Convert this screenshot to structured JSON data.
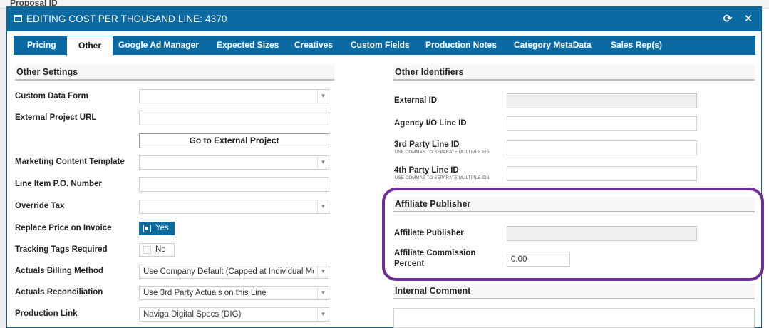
{
  "background": {
    "top_text": "Proposal ID"
  },
  "dialog": {
    "title": "EDITING COST PER THOUSAND LINE: 4370",
    "refresh_icon": "refresh-icon",
    "close_icon": "close-icon",
    "close_glyph": "✕",
    "refresh_glyph": "⟳"
  },
  "tabs": [
    {
      "label": "Pricing",
      "active": false
    },
    {
      "label": "Other",
      "active": true
    },
    {
      "label": "Google Ad Manager",
      "active": false
    },
    {
      "label": "Expected Sizes",
      "active": false
    },
    {
      "label": "Creatives",
      "active": false
    },
    {
      "label": "Custom Fields",
      "active": false
    },
    {
      "label": "Production Notes",
      "active": false
    },
    {
      "label": "Category MetaData",
      "active": false
    },
    {
      "label": "Sales Rep(s)",
      "active": false
    }
  ],
  "other_settings": {
    "heading": "Other Settings",
    "custom_data_form": {
      "label": "Custom Data Form",
      "value": ""
    },
    "external_project_url": {
      "label": "External Project URL",
      "value": ""
    },
    "go_to_external_project": "Go to External Project",
    "marketing_content_template": {
      "label": "Marketing Content Template",
      "value": ""
    },
    "line_item_po_number": {
      "label": "Line Item P.O. Number",
      "value": ""
    },
    "override_tax": {
      "label": "Override Tax",
      "value": ""
    },
    "replace_price_on_invoice": {
      "label": "Replace Price on Invoice",
      "value": "Yes",
      "checked": true
    },
    "tracking_tags_required": {
      "label": "Tracking Tags Required",
      "value": "No",
      "checked": false
    },
    "actuals_billing_method": {
      "label": "Actuals Billing Method",
      "value": "Use Company Default (Capped at Individual Mo"
    },
    "actuals_reconciliation": {
      "label": "Actuals Reconciliation",
      "value": "Use 3rd Party Actuals on this Line"
    },
    "production_link": {
      "label": "Production Link",
      "value": "Naviga Digital Specs (DIG)"
    }
  },
  "other_identifiers": {
    "heading": "Other Identifiers",
    "external_id": {
      "label": "External ID",
      "value": ""
    },
    "agency_io_line_id": {
      "label": "Agency I/O Line ID",
      "value": ""
    },
    "third_party_line_id": {
      "label": "3rd Party Line ID",
      "hint": "USE COMMAS TO SEPARATE MULTIPLE IDS",
      "value": ""
    },
    "fourth_party_line_id": {
      "label": "4th Party Line ID",
      "hint": "USE COMMAS TO SEPARATE MULTIPLE IDS",
      "value": ""
    }
  },
  "affiliate_publisher": {
    "heading": "Affiliate Publisher",
    "publisher": {
      "label": "Affiliate Publisher",
      "value": ""
    },
    "commission_percent": {
      "label_line1": "Affiliate Commission",
      "label_line2": "Percent",
      "value": "0.00"
    },
    "highlight_color": "#6d2f97"
  },
  "internal_comment": {
    "heading": "Internal Comment",
    "value": ""
  },
  "colors": {
    "brand": "#0b6aa2"
  }
}
